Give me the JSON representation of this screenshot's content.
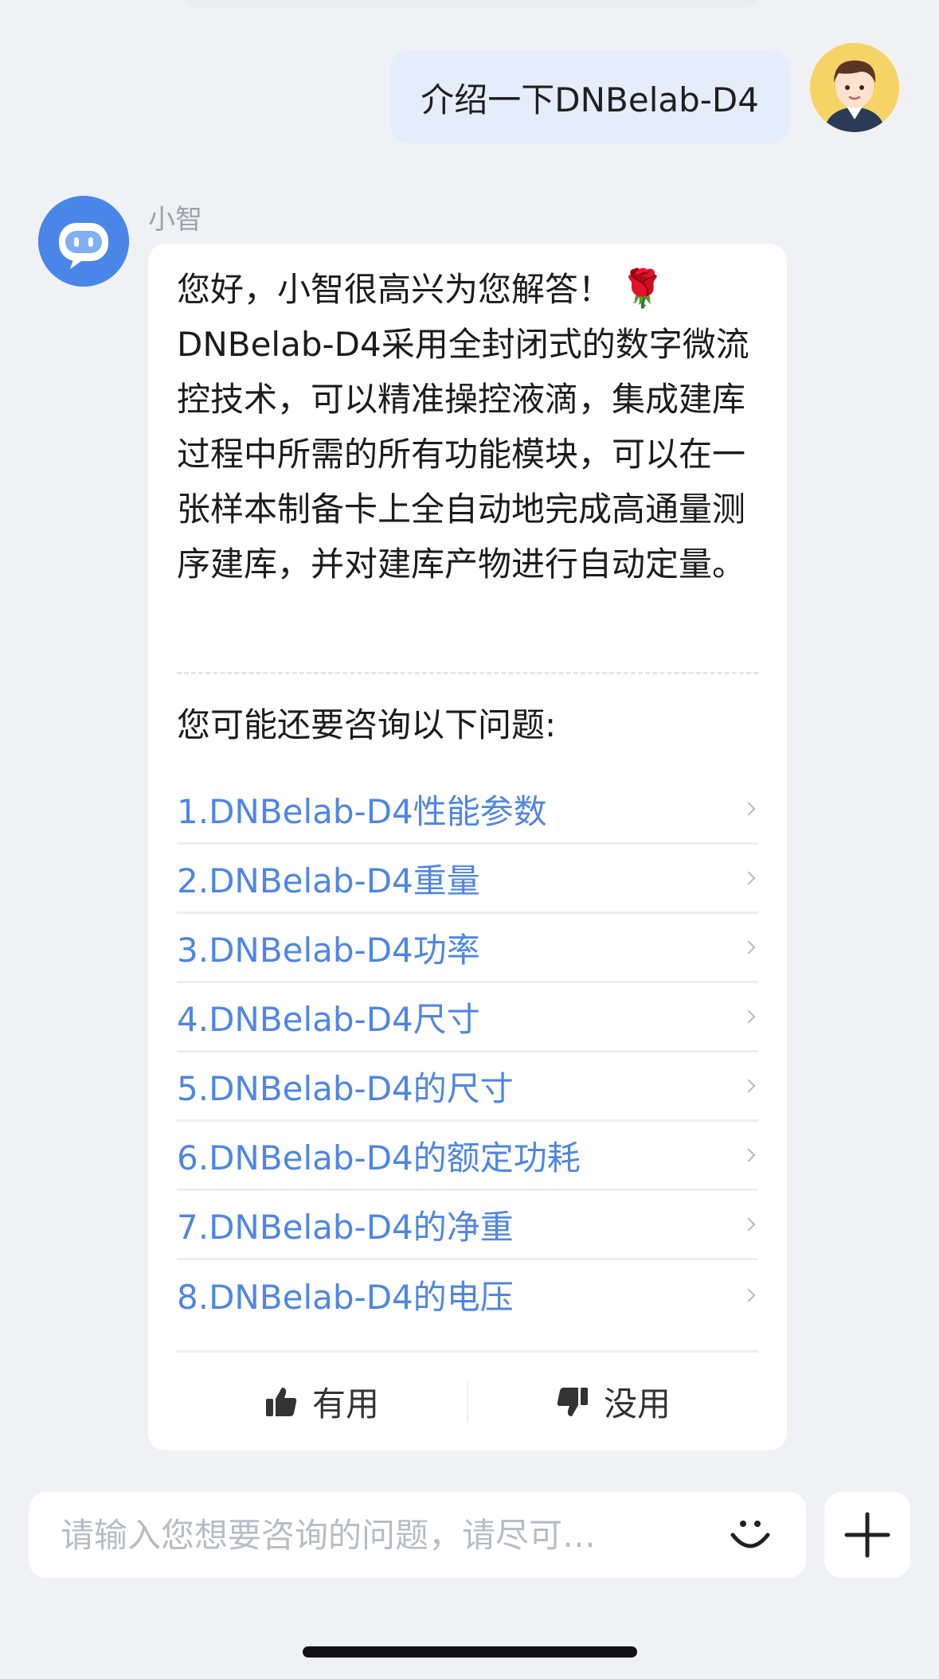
{
  "user_message": {
    "text": "介绍一下DNBelab-D4"
  },
  "bot": {
    "name": "小智",
    "answer": "您好，小智很高兴为您解答！",
    "answer_body": "DNBelab-D4采用全封闭式的数字微流控技术，可以精准操控液滴，集成建库过程中所需的所有功能模块，可以在一张样本制备卡上全自动地完成高通量测序建库，并对建库产物进行自动定量。",
    "rose_icon": "🌹",
    "suggest_heading": "您可能还要咨询以下问题:",
    "suggestions": [
      "1.DNBelab-D4性能参数",
      "2.DNBelab-D4重量",
      "3.DNBelab-D4功率",
      "4.DNBelab-D4尺寸",
      "5.DNBelab-D4的尺寸",
      "6.DNBelab-D4的额定功耗",
      "7.DNBelab-D4的净重",
      "8.DNBelab-D4的电压"
    ],
    "feedback": {
      "useful": "有用",
      "useless": "没用"
    }
  },
  "input": {
    "placeholder": "请输入您想要咨询的问题，请尽可…",
    "value": ""
  },
  "colors": {
    "background": "#eff1f5",
    "user_bubble": "#e3edfb",
    "bot_avatar": "#4a86e8",
    "link": "#5086e3"
  },
  "icons": {
    "emoji": "smile-icon",
    "plus": "plus-icon",
    "thumb_up": "thumbs-up-icon",
    "thumb_down": "thumbs-down-icon"
  }
}
